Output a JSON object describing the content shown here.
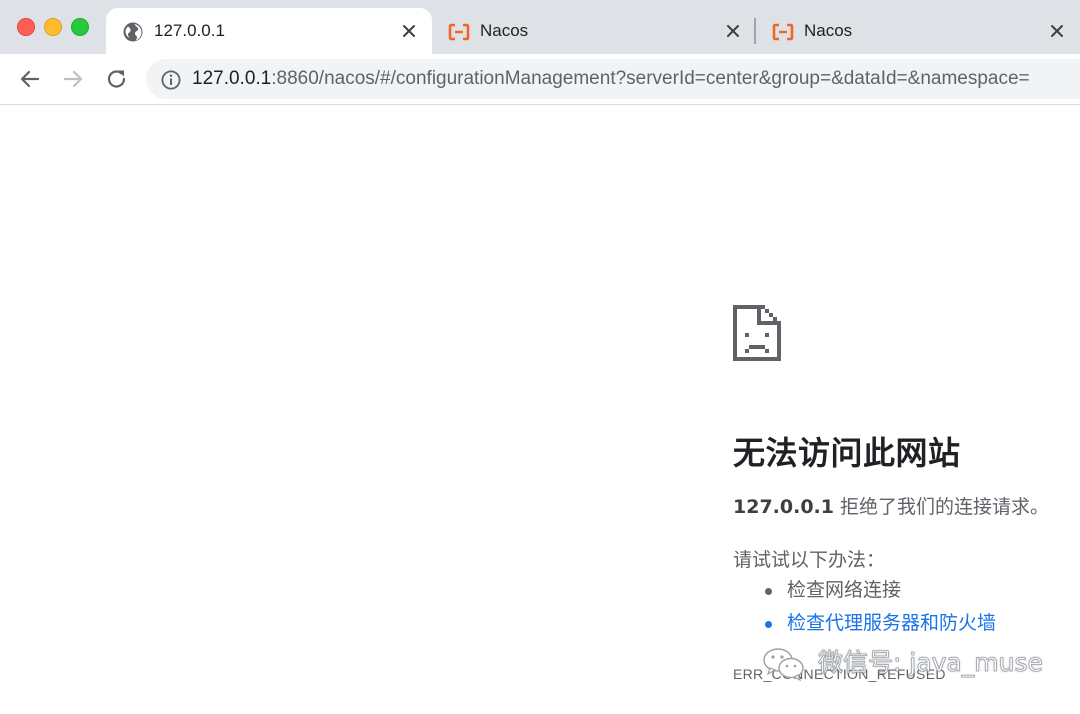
{
  "browser": {
    "window_controls": [
      "close",
      "minimize",
      "zoom"
    ],
    "tabs": [
      {
        "title": "127.0.0.1",
        "icon": "globe-icon",
        "active": true
      },
      {
        "title": "Nacos",
        "icon": "nacos-logo-icon",
        "active": false
      },
      {
        "title": "Nacos",
        "icon": "nacos-logo-icon",
        "active": false
      }
    ],
    "url_host": "127.0.0.1",
    "url_rest": ":8860/nacos/#/configurationManagement?serverId=center&group=&dataId=&namespace=",
    "colors": {
      "tabstrip": "#dee1e6",
      "omnibox": "#f1f3f4",
      "link": "#1a73e8",
      "accent_nacos": "#f26522"
    }
  },
  "error_page": {
    "icon": "sad-page-icon",
    "heading": "无法访问此网站",
    "host": "127.0.0.1",
    "message": " 拒绝了我们的连接请求。",
    "suggestions_title": "请试试以下办法：",
    "suggestions": [
      {
        "text": "检查网络连接",
        "is_link": false
      },
      {
        "text": "检查代理服务器和防火墙",
        "is_link": true
      }
    ],
    "error_code": "ERR_CONNECTION_REFUSED"
  },
  "watermark": {
    "text": "微信号: java_muse",
    "icon": "wechat-icon"
  }
}
